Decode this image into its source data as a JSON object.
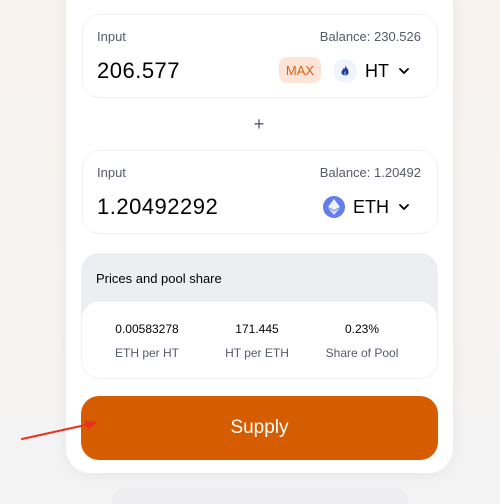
{
  "input_a": {
    "label": "Input",
    "balance": "Balance: 230.526",
    "amount": "206.577",
    "max_label": "MAX",
    "token": "HT",
    "token_icon": "ht-flame-icon"
  },
  "plus_symbol": "+",
  "input_b": {
    "label": "Input",
    "balance": "Balance: 1.20492",
    "amount": "1.20492292",
    "token": "ETH",
    "token_icon": "eth-icon"
  },
  "prices": {
    "title": "Prices and pool share",
    "stats": [
      {
        "value": "0.00583278",
        "label": "ETH per HT"
      },
      {
        "value": "171.445",
        "label": "HT per ETH"
      },
      {
        "value": "0.23%",
        "label": "Share of Pool"
      }
    ]
  },
  "supply_label": "Supply",
  "colors": {
    "accent": "#d65c00",
    "max_bg": "#fde4d7",
    "max_text": "#d9601a",
    "annotation_arrow": "#e8331c",
    "eth_blue": "#627eea"
  }
}
